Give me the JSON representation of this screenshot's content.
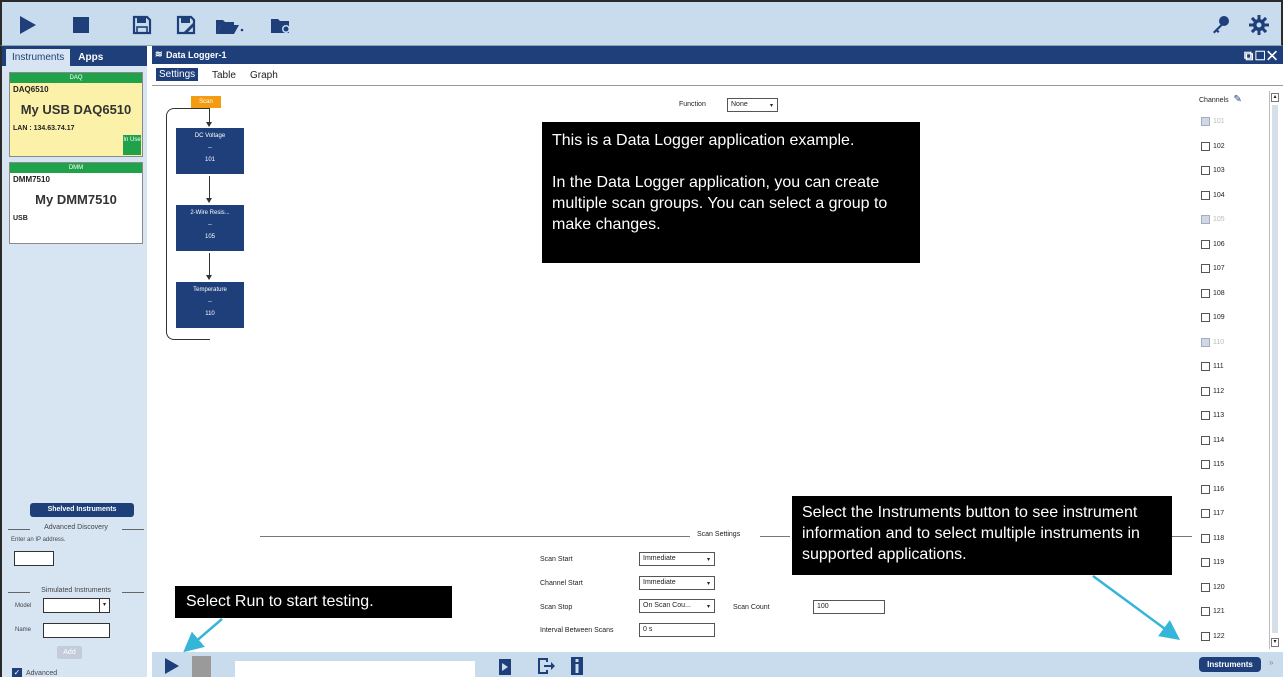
{
  "toolbar": {
    "icons": [
      "play-icon",
      "stop-icon",
      "save-icon",
      "save-as-icon",
      "open-icon",
      "new-folder-icon",
      "key-icon",
      "gear-icon"
    ]
  },
  "left_panel": {
    "tabs": [
      "Instruments",
      "Apps"
    ],
    "instruments": [
      {
        "category": "DAQ",
        "model": "DAQ6510",
        "name": "My USB DAQ6510",
        "connection": "LAN : 134.63.74.17",
        "status": "In Use"
      },
      {
        "category": "DMM",
        "model": "DMM7510",
        "name": "My DMM7510",
        "connection": "USB",
        "status": ""
      }
    ],
    "shelved_label": "Shelved Instruments",
    "advanced_discovery": "Advanced Discovery",
    "ip_label": "Enter an IP address.",
    "simulated": "Simulated Instruments",
    "model_label": "Model",
    "name_label": "Name",
    "add_label": "Add",
    "advanced_label": "Advanced"
  },
  "main": {
    "title": "Data Logger-1",
    "window_icons": "⧉☐✕",
    "tabs": [
      "Settings",
      "Table",
      "Graph"
    ],
    "scan_label": "Scan",
    "flow": [
      {
        "title": "DC Voltage",
        "dash": "--",
        "channel": "101"
      },
      {
        "title": "2-Wire Resis...",
        "dash": "--",
        "channel": "105"
      },
      {
        "title": "Temperature",
        "dash": "--",
        "channel": "110"
      }
    ],
    "function_label": "Function",
    "function_value": "None",
    "channels_label": "Channels",
    "channels": [
      {
        "id": "101",
        "disabled": true
      },
      {
        "id": "102",
        "disabled": false
      },
      {
        "id": "103",
        "disabled": false
      },
      {
        "id": "104",
        "disabled": false
      },
      {
        "id": "105",
        "disabled": true
      },
      {
        "id": "106",
        "disabled": false
      },
      {
        "id": "107",
        "disabled": false
      },
      {
        "id": "108",
        "disabled": false
      },
      {
        "id": "109",
        "disabled": false
      },
      {
        "id": "110",
        "disabled": true
      },
      {
        "id": "111",
        "disabled": false
      },
      {
        "id": "112",
        "disabled": false
      },
      {
        "id": "113",
        "disabled": false
      },
      {
        "id": "114",
        "disabled": false
      },
      {
        "id": "115",
        "disabled": false
      },
      {
        "id": "116",
        "disabled": false
      },
      {
        "id": "117",
        "disabled": false
      },
      {
        "id": "118",
        "disabled": false
      },
      {
        "id": "119",
        "disabled": false
      },
      {
        "id": "120",
        "disabled": false
      },
      {
        "id": "121",
        "disabled": false
      },
      {
        "id": "122",
        "disabled": false
      }
    ],
    "scan_settings": {
      "title": "Scan Settings",
      "scan_start_label": "Scan Start",
      "scan_start_value": "Immediate",
      "channel_start_label": "Channel Start",
      "channel_start_value": "Immediate",
      "scan_stop_label": "Scan Stop",
      "scan_stop_value": "On Scan Cou...",
      "scan_count_label": "Scan Count",
      "scan_count_value": "100",
      "interval_label": "Interval Between Scans",
      "interval_value": "0 s"
    }
  },
  "callouts": {
    "datalogger_line1": "This is a Data Logger application example.",
    "datalogger_line2": "In the Data Logger application, you can create multiple scan groups. You can select a group to make changes.",
    "instruments": "Select the Instruments button to see instrument information and to select multiple instruments in supported applications.",
    "run": "Select Run to start testing."
  },
  "bottom": {
    "instruments_label": "Instruments"
  },
  "colors": {
    "navy": "#1e3f7a",
    "green": "#1fa24a",
    "orange": "#f39c12",
    "highlight": "#fbf1a9",
    "callout_arrow": "#35b5d8"
  }
}
